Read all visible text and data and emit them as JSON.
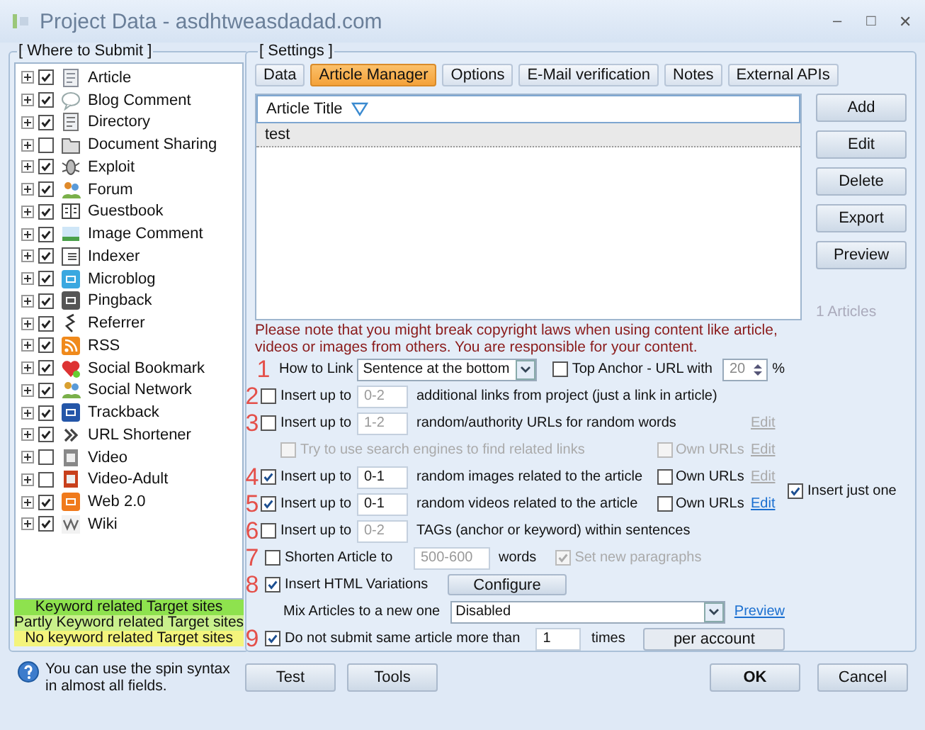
{
  "window": {
    "title": "Project Data - asdhtweasdadad.com",
    "controls": [
      "–",
      "□",
      "✕"
    ]
  },
  "where_to_submit": {
    "title": "[ Where to Submit ]",
    "items": [
      {
        "label": "Article",
        "checked": true
      },
      {
        "label": "Blog Comment",
        "checked": true
      },
      {
        "label": "Directory",
        "checked": true
      },
      {
        "label": "Document Sharing",
        "checked": false
      },
      {
        "label": "Exploit",
        "checked": true
      },
      {
        "label": "Forum",
        "checked": true
      },
      {
        "label": "Guestbook",
        "checked": true
      },
      {
        "label": "Image Comment",
        "checked": true
      },
      {
        "label": "Indexer",
        "checked": true
      },
      {
        "label": "Microblog",
        "checked": true
      },
      {
        "label": "Pingback",
        "checked": true
      },
      {
        "label": "Referrer",
        "checked": true
      },
      {
        "label": "RSS",
        "checked": true
      },
      {
        "label": "Social Bookmark",
        "checked": true
      },
      {
        "label": "Social Network",
        "checked": true
      },
      {
        "label": "Trackback",
        "checked": true
      },
      {
        "label": "URL Shortener",
        "checked": true
      },
      {
        "label": "Video",
        "checked": false
      },
      {
        "label": "Video-Adult",
        "checked": false
      },
      {
        "label": "Web 2.0",
        "checked": true
      },
      {
        "label": "Wiki",
        "checked": true
      }
    ],
    "legend": [
      {
        "label": "Keyword related Target sites",
        "color": "#8ee24e"
      },
      {
        "label": "Partly Keyword related Target sites",
        "color": "#c9f08c"
      },
      {
        "label": "No keyword related Target sites",
        "color": "#f4f47c"
      }
    ]
  },
  "help": "You can use the spin syntax in almost all fields.",
  "settings": {
    "title": "[ Settings ]",
    "tabs": [
      {
        "label": "Data",
        "selected": false
      },
      {
        "label": "Article Manager",
        "selected": true
      },
      {
        "label": "Options",
        "selected": false
      },
      {
        "label": "E-Mail verification",
        "selected": false
      },
      {
        "label": "Notes",
        "selected": false
      },
      {
        "label": "External APIs",
        "selected": false
      }
    ],
    "articles": {
      "column": "Article Title",
      "rows": [
        {
          "title": "test",
          "selected": true
        }
      ],
      "count": "1 Articles"
    },
    "actions": [
      "Add",
      "Edit",
      "Delete",
      "Export",
      "Preview"
    ],
    "warning": "Please note that you might break copyright laws when using content like article, videos or images from others. You are responsible for your content.",
    "options": [
      {
        "kind": "link_method",
        "number": "1",
        "label": "How to Link",
        "value": "Sentence at the bottom",
        "toggle": {
          "label": "Top Anchor - URL with",
          "checked": false
        },
        "spin": "20",
        "unit": "%"
      },
      {
        "kind": "insert",
        "number": "2",
        "checked": false,
        "label": "Insert up to",
        "value": "0-2",
        "text": "additional links from project (just a link in article)"
      },
      {
        "kind": "insert",
        "number": "3",
        "checked": false,
        "label": "Insert up to",
        "value": "1-2",
        "text": "random/authority URLs for random words",
        "edit": {
          "label": "Edit",
          "disabled": true
        }
      },
      {
        "kind": "sub_option",
        "checked": false,
        "disabled": true,
        "label": "Try to use search engines to find related links",
        "own": {
          "label": "Own URLs",
          "checked": false,
          "disabled": true
        },
        "edit": {
          "label": "Edit",
          "disabled": true
        }
      },
      {
        "kind": "insert",
        "number": "4",
        "checked": true,
        "label": "Insert up to",
        "value": "0-1",
        "text": "random images related to the article",
        "own": {
          "label": "Own URLs",
          "checked": false,
          "disabled": false
        },
        "edit": {
          "label": "Edit",
          "disabled": true
        }
      },
      {
        "kind": "insert",
        "number": "5",
        "checked": true,
        "label": "Insert up to",
        "value": "0-1",
        "text": "random videos related to the article",
        "own": {
          "label": "Own URLs",
          "checked": false,
          "disabled": false
        },
        "edit": {
          "label": "Edit",
          "disabled": false
        }
      },
      {
        "kind": "insert",
        "number": "6",
        "checked": false,
        "label": "Insert up to",
        "value": "0-2",
        "text": "TAGs (anchor or keyword) within sentences"
      },
      {
        "kind": "shorten",
        "number": "7",
        "checked": false,
        "label": "Shorten Article to",
        "value": "500-600",
        "suffix": "words",
        "extra": {
          "label": "Set new paragraphs",
          "checked": true,
          "disabled": true
        }
      },
      {
        "kind": "html",
        "number": "8",
        "checked": true,
        "label": "Insert HTML Variations",
        "button": "Configure"
      },
      {
        "kind": "mix",
        "label": "Mix Articles to a new one",
        "value": "Disabled",
        "link": "Preview"
      },
      {
        "kind": "limit",
        "number": "9",
        "checked": true,
        "label": "Do not submit same article more than",
        "value": "1",
        "suffix": "times",
        "button": "per account"
      }
    ],
    "insert_just_one": {
      "label": "Insert just one",
      "checked": true
    }
  },
  "footer": {
    "left": [
      "Test",
      "Tools"
    ],
    "ok": "OK",
    "cancel": "Cancel"
  }
}
